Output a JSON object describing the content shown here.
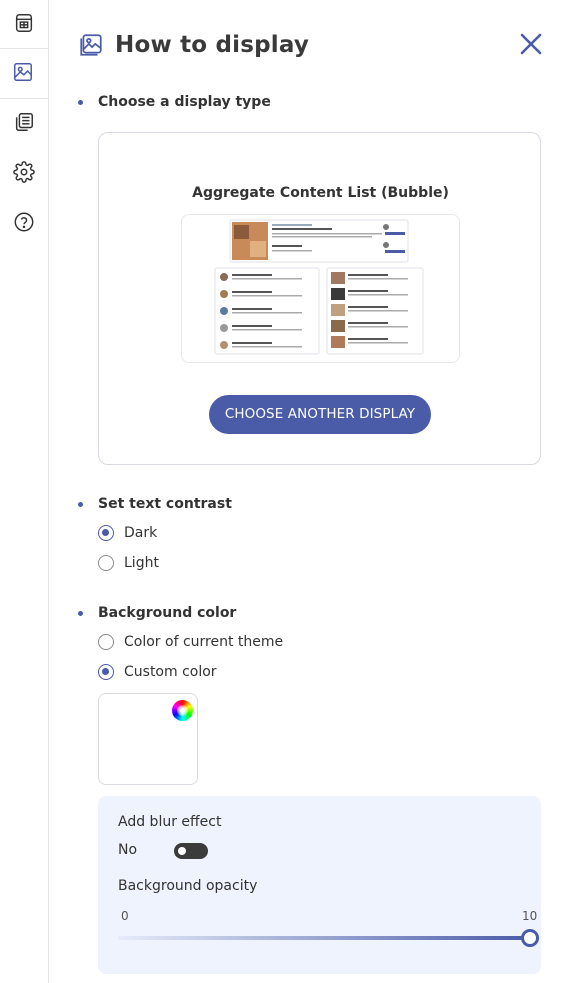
{
  "sidebar": {
    "items": [
      {
        "icon": "layout-table-icon"
      },
      {
        "icon": "image-icon",
        "active": true
      },
      {
        "icon": "content-list-icon"
      },
      {
        "icon": "gear-icon"
      },
      {
        "icon": "help-icon"
      }
    ]
  },
  "header": {
    "title": "How to display",
    "icon": "image-icon",
    "close_icon": "close-icon"
  },
  "display_type": {
    "label": "Choose a display type",
    "current": "Aggregate Content List (Bubble)",
    "button": "CHOOSE ANOTHER DISPLAY"
  },
  "text_contrast": {
    "label": "Set text contrast",
    "options": [
      {
        "label": "Dark",
        "selected": true
      },
      {
        "label": "Light",
        "selected": false
      }
    ]
  },
  "background_color": {
    "label": "Background color",
    "options": [
      {
        "label": "Color of current theme",
        "selected": false
      },
      {
        "label": "Custom color",
        "selected": true
      }
    ],
    "swatch_color": "#ffffff"
  },
  "effects": {
    "blur_label": "Add blur effect",
    "blur_value": "No",
    "blur_enabled": false,
    "opacity_label": "Background opacity",
    "opacity_min": "0",
    "opacity_max": "10",
    "opacity_value": 10
  },
  "colors": {
    "accent": "#4a5ba8",
    "panel_bg": "#eef3fd",
    "toggle_off": "#3b3b3b"
  }
}
